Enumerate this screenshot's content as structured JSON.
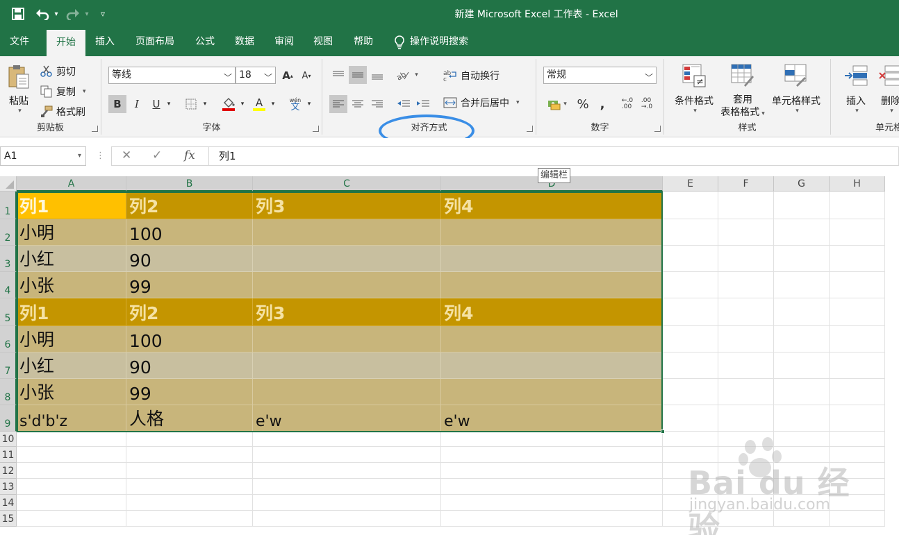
{
  "window": {
    "title": "新建 Microsoft Excel 工作表  -  Excel",
    "qa": {
      "save": "🖫",
      "undo": "↶",
      "undo_caret": "▾",
      "redo": "↷",
      "redo_caret": "▾",
      "customize": "▿"
    }
  },
  "tabs": {
    "file": "文件",
    "home": "开始",
    "insert": "插入",
    "layout": "页面布局",
    "formulas": "公式",
    "data": "数据",
    "review": "审阅",
    "view": "视图",
    "help": "帮助",
    "search": "操作说明搜索"
  },
  "clipboard": {
    "paste": "粘贴",
    "cut": "剪切",
    "copy": "复制",
    "format_painter": "格式刷",
    "label": "剪贴板"
  },
  "font": {
    "name": "等线",
    "size": "18",
    "bold": "B",
    "italic": "I",
    "underline": "U",
    "grow": "A",
    "shrink": "A",
    "font_color_letter": "A",
    "phonetic": "wén",
    "phonetic_char": "文",
    "label": "字体"
  },
  "alignment": {
    "wrap_text": "自动换行",
    "merge_center": "合并后居中",
    "label": "对齐方式"
  },
  "number": {
    "format": "常规",
    "percent": "%",
    "comma": ",",
    "inc_decimal": "←.0\n.00",
    "dec_decimal": ".00\n→.0",
    "label": "数字"
  },
  "styles": {
    "conditional": "条件格式",
    "table_line1": "套用",
    "table_line2": "表格格式",
    "cell_styles": "单元格样式",
    "label": "样式"
  },
  "cells": {
    "insert": "插入",
    "delete": "删除",
    "label": "单元格"
  },
  "formula_bar": {
    "name_box": "A1",
    "content": "列1",
    "fx": "fx",
    "cancel": "✕",
    "enter": "✓",
    "sep": "⋮"
  },
  "tooltip": "编辑栏",
  "columns": [
    "A",
    "B",
    "C",
    "D",
    "E",
    "F",
    "G",
    "H"
  ],
  "rows": [
    "1",
    "2",
    "3",
    "4",
    "5",
    "6",
    "7",
    "8",
    "9",
    "10",
    "11",
    "12",
    "13",
    "14",
    "15"
  ],
  "cells_data": [
    [
      "列1",
      "列2",
      "列3",
      "列4"
    ],
    [
      "小明",
      "100",
      "",
      ""
    ],
    [
      "小红",
      "90",
      "",
      ""
    ],
    [
      "小张",
      "99",
      "",
      ""
    ],
    [
      "列1",
      "列2",
      "列3",
      "列4"
    ],
    [
      "小明",
      "100",
      "",
      ""
    ],
    [
      "小红",
      "90",
      "",
      ""
    ],
    [
      "小张",
      "99",
      "",
      ""
    ],
    [
      "s'd'b'z",
      "人格",
      "e'w",
      "e'w"
    ]
  ],
  "watermark": {
    "logo": "Bai du 经验",
    "url": "jingyan.baidu.com"
  },
  "colors": {
    "excel_green": "#217346",
    "header_band": "#c49500",
    "selected_cell": "#ffc000",
    "band1": "#c8b57b",
    "band2": "#c8bf9f",
    "highlight": "#3a8ee6"
  }
}
